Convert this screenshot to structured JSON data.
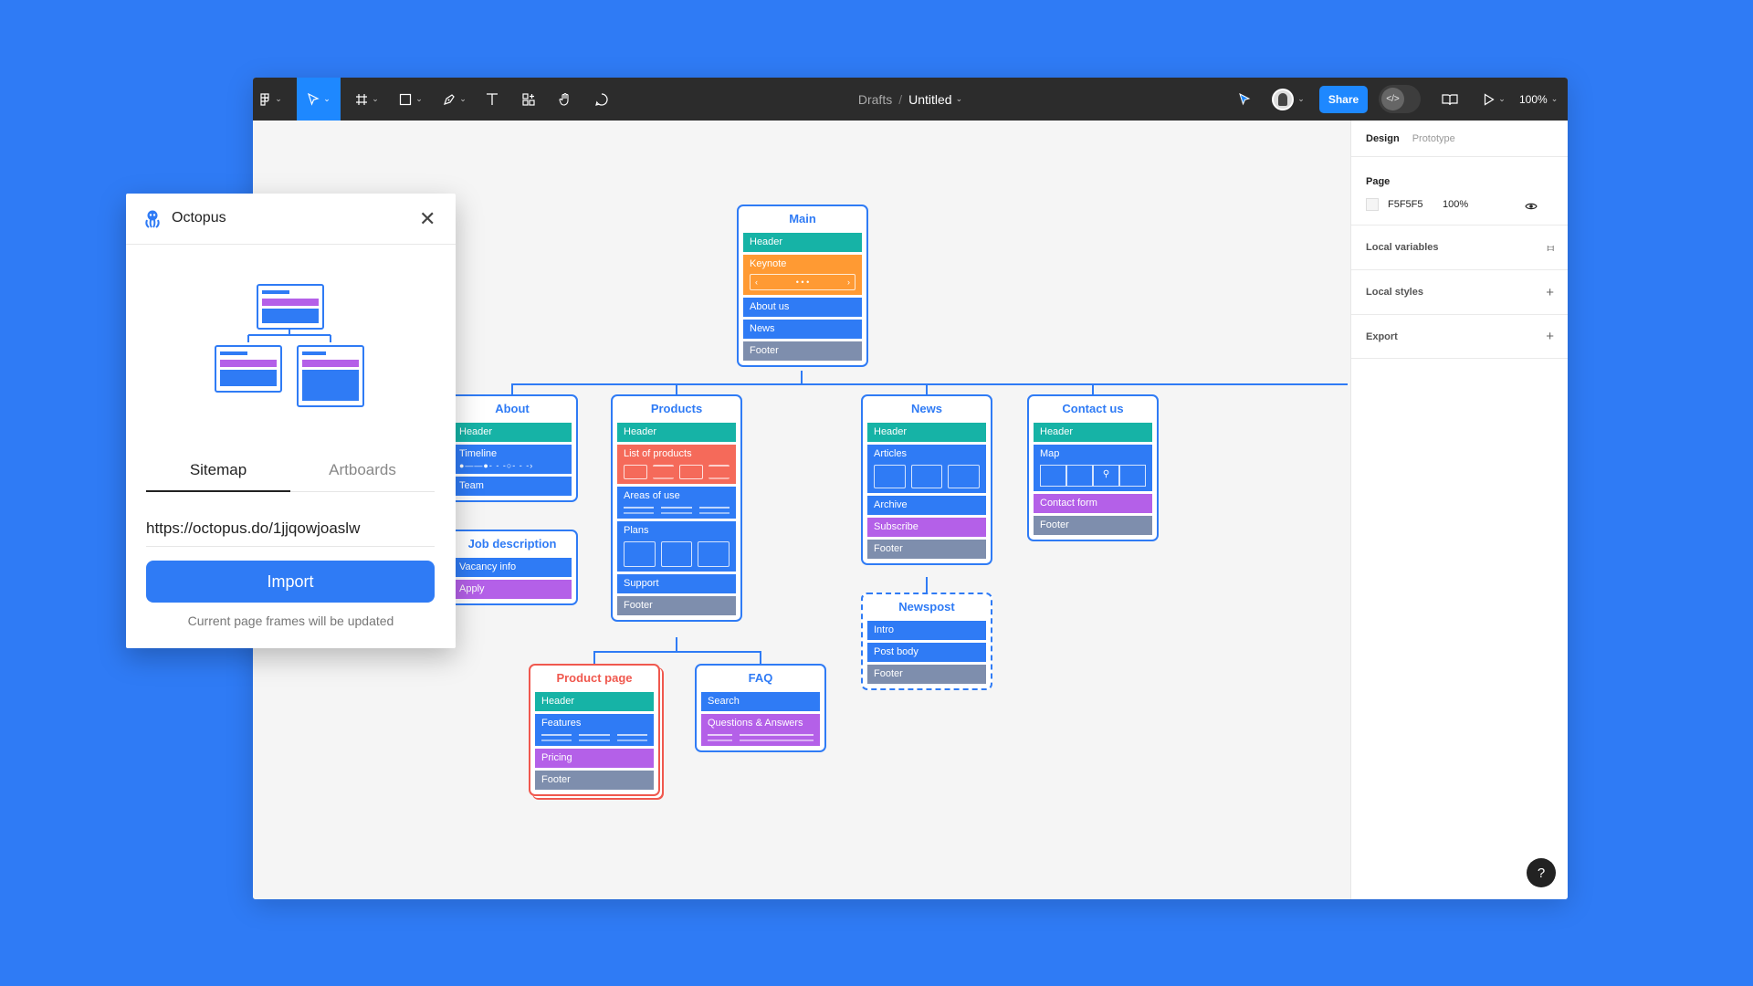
{
  "toolbar": {
    "breadcrumb_parent": "Drafts",
    "breadcrumb_sep": "/",
    "file_name": "Untitled",
    "share_label": "Share",
    "zoom_level": "100%",
    "tools": [
      "main-menu-icon",
      "move-tool-icon",
      "frame-tool-icon",
      "shape-tool-icon",
      "pen-tool-icon",
      "text-tool-icon",
      "resources-icon",
      "hand-tool-icon",
      "comment-icon"
    ],
    "accent": "#1E88FF"
  },
  "right_panel": {
    "tabs": [
      "Design",
      "Prototype"
    ],
    "page_label": "Page",
    "page_color": "F5F5F5",
    "page_opacity": "100%",
    "sections": [
      "Local variables",
      "Local styles",
      "Export"
    ],
    "help_label": "?"
  },
  "plugin": {
    "title": "Octopus",
    "tabs": [
      "Sitemap",
      "Artboards"
    ],
    "url_value": "https://octopus.do/1jjqowjoaslw",
    "import_label": "Import",
    "note": "Current page frames will be updated"
  },
  "sitemap": {
    "main": {
      "title": "Main",
      "blocks": [
        "Header",
        "Keynote",
        "About us",
        "News",
        "Footer"
      ]
    },
    "about": {
      "title": "About",
      "blocks": [
        "Header",
        "Timeline",
        "Team"
      ]
    },
    "job": {
      "title": "Job description",
      "blocks": [
        "Vacancy info",
        "Apply"
      ]
    },
    "products": {
      "title": "Products",
      "blocks": [
        "Header",
        "List of products",
        "Areas of use",
        "Plans",
        "Support",
        "Footer"
      ]
    },
    "product_page": {
      "title": "Product page",
      "blocks": [
        "Header",
        "Features",
        "Pricing",
        "Footer"
      ]
    },
    "faq": {
      "title": "FAQ",
      "blocks": [
        "Search",
        "Questions & Answers"
      ]
    },
    "news": {
      "title": "News",
      "blocks": [
        "Header",
        "Articles",
        "Archive",
        "Subscribe",
        "Footer"
      ]
    },
    "newspost": {
      "title": "Newspost",
      "blocks": [
        "Intro",
        "Post body",
        "Footer"
      ]
    },
    "contact": {
      "title": "Contact us",
      "blocks": [
        "Header",
        "Map",
        "Contact form",
        "Footer"
      ]
    },
    "colors": {
      "blue": "#2F7BF5",
      "teal": "#16B3A6",
      "orange": "#FF9A33",
      "purple": "#B460E8",
      "grey": "#7E8EAD",
      "coral": "#F56A5A",
      "red": "#F0584E"
    }
  }
}
